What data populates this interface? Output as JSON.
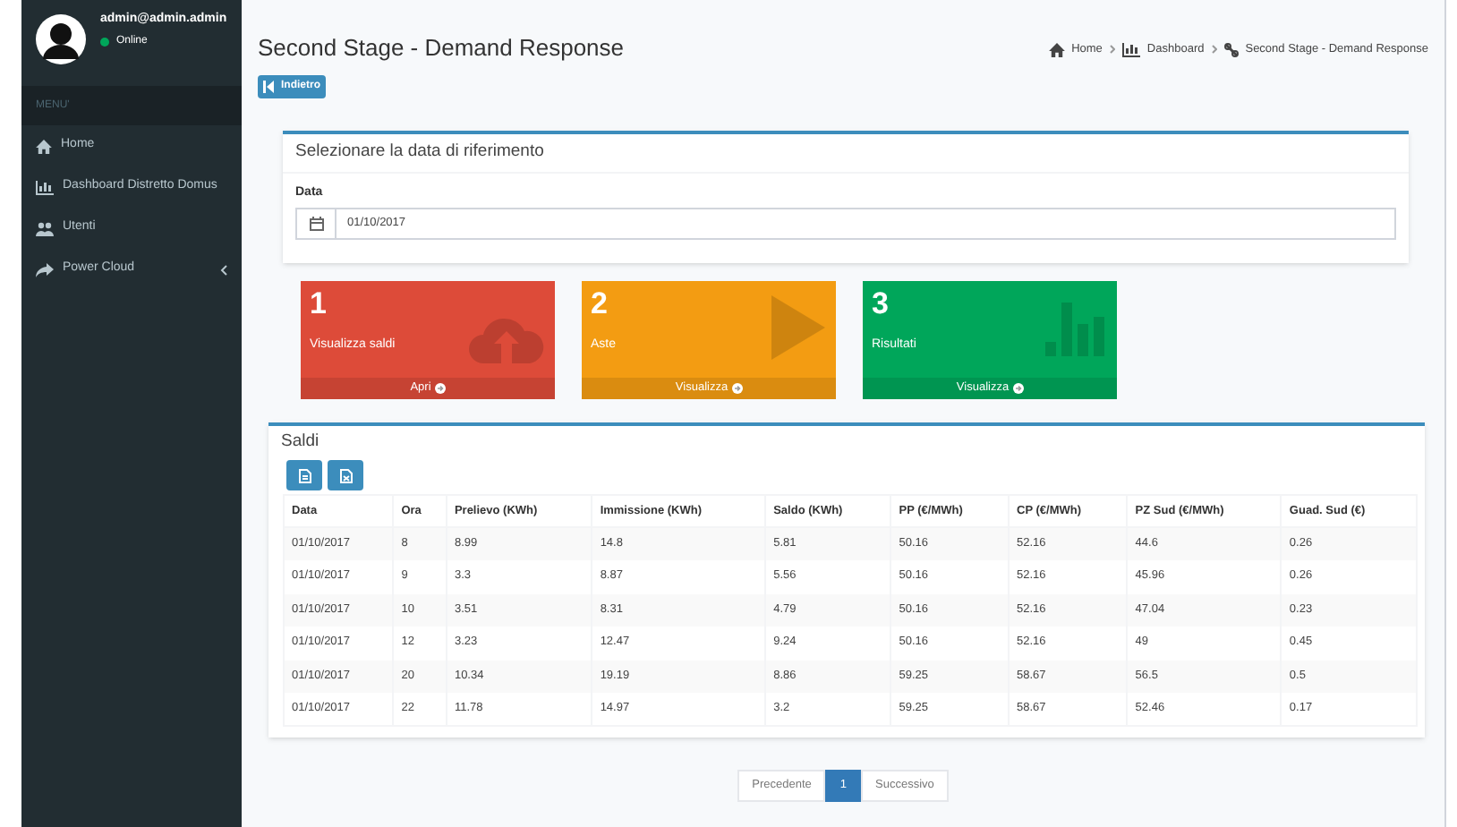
{
  "user": {
    "name": "admin@admin.admin",
    "status": "Online"
  },
  "sidebar": {
    "header": "MENU'",
    "items": [
      {
        "kind": "home",
        "label": "Home",
        "expandable": false
      },
      {
        "kind": "chart",
        "label": "Dashboard Distretto Domus",
        "expandable": false
      },
      {
        "kind": "users",
        "label": "Utenti",
        "expandable": false
      },
      {
        "kind": "share",
        "label": "Power Cloud",
        "expandable": true
      }
    ]
  },
  "page_title": "Second Stage - Demand Response",
  "breadcrumb": [
    {
      "kind": "home",
      "label": "Home"
    },
    {
      "kind": "chart",
      "label": "Dashboard"
    },
    {
      "kind": "link",
      "label": "Second Stage - Demand Response"
    }
  ],
  "back_button": "Indietro",
  "date_box": {
    "title": "Selezionare la data di riferimento",
    "label": "Data",
    "value": "01/10/2017"
  },
  "tiles": [
    {
      "kind": "cloud",
      "number": "1",
      "label": "Visualizza saldi",
      "action": "Apri"
    },
    {
      "kind": "play",
      "number": "2",
      "label": "Aste",
      "action": "Visualizza"
    },
    {
      "kind": "bars",
      "number": "3",
      "label": "Risultati",
      "action": "Visualizza"
    }
  ],
  "saldi": {
    "title": "Saldi",
    "columns": [
      "Data",
      "Ora",
      "Prelievo (KWh)",
      "Immissione (KWh)",
      "Saldo (KWh)",
      "PP (€/MWh)",
      "CP (€/MWh)",
      "PZ Sud (€/MWh)",
      "Guad. Sud (€)"
    ],
    "rows": [
      [
        "01/10/2017",
        "8",
        "8.99",
        "14.8",
        "5.81",
        "50.16",
        "52.16",
        "44.6",
        "0.26"
      ],
      [
        "01/10/2017",
        "9",
        "3.3",
        "8.87",
        "5.56",
        "50.16",
        "52.16",
        "45.96",
        "0.26"
      ],
      [
        "01/10/2017",
        "10",
        "3.51",
        "8.31",
        "4.79",
        "50.16",
        "52.16",
        "47.04",
        "0.23"
      ],
      [
        "01/10/2017",
        "12",
        "3.23",
        "12.47",
        "9.24",
        "50.16",
        "52.16",
        "49",
        "0.45"
      ],
      [
        "01/10/2017",
        "20",
        "10.34",
        "19.19",
        "8.86",
        "59.25",
        "58.67",
        "56.5",
        "0.5"
      ],
      [
        "01/10/2017",
        "22",
        "11.78",
        "14.97",
        "3.2",
        "59.25",
        "58.67",
        "52.46",
        "0.17"
      ]
    ]
  },
  "pagination": [
    {
      "label": "Precedente",
      "selected": false
    },
    {
      "label": "1",
      "selected": true
    },
    {
      "label": "Successivo",
      "selected": false
    }
  ]
}
